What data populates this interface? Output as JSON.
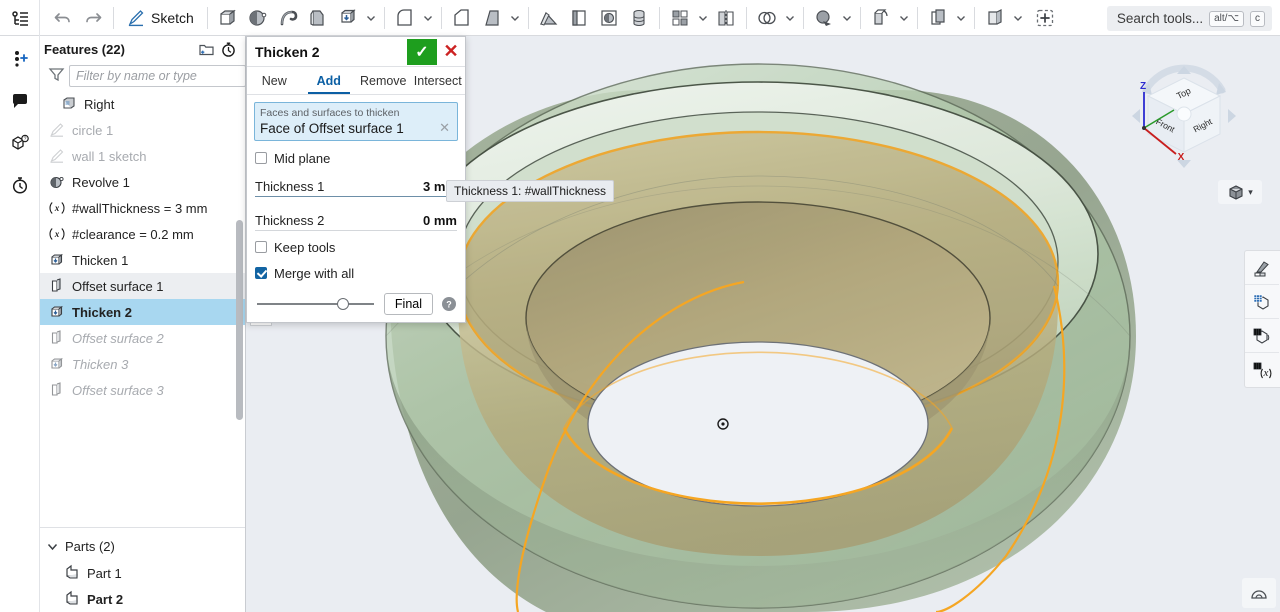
{
  "toolbar": {
    "history_icon": "feature-history-icon",
    "undo_label": "undo-icon",
    "redo_label": "redo-icon",
    "sketch_label": "Sketch",
    "tools": [
      {
        "name": "extrude-icon",
        "caret": false
      },
      {
        "name": "revolve-icon",
        "caret": false
      },
      {
        "name": "sweep-icon",
        "caret": false
      },
      {
        "name": "loft-icon",
        "caret": false
      },
      {
        "name": "thicken-icon",
        "caret": true
      },
      {
        "name": "fillet-icon",
        "caret": true
      },
      {
        "name": "chamfer-icon",
        "caret": false
      },
      {
        "name": "draft-icon",
        "caret": true
      },
      {
        "name": "rib-icon",
        "caret": false
      },
      {
        "name": "shell-icon",
        "caret": false
      },
      {
        "name": "hole-icon",
        "caret": false
      },
      {
        "name": "thread-icon",
        "caret": false
      },
      {
        "name": "pattern-icon",
        "caret": true
      },
      {
        "name": "mirror-icon",
        "caret": false
      },
      {
        "name": "boolean-icon",
        "caret": true
      },
      {
        "name": "split-icon",
        "caret": true
      },
      {
        "name": "transform-icon",
        "caret": true
      },
      {
        "name": "offset-surface-icon",
        "caret": true
      },
      {
        "name": "enclose-icon",
        "caret": true
      },
      {
        "name": "add-custom-feature-icon",
        "caret": false
      }
    ],
    "search_placeholder": "Search tools...",
    "search_kbd_1": "alt/⌥",
    "search_kbd_2": "c"
  },
  "rail": {
    "items": [
      {
        "name": "add-collaborator-icon"
      },
      {
        "name": "comment-icon"
      },
      {
        "name": "part-info-icon"
      },
      {
        "name": "history-icon"
      }
    ]
  },
  "tree": {
    "title": "Features (22)",
    "add_folder_icon": "add-folder-icon",
    "rollback_icon": "stopwatch-icon",
    "filter_placeholder": "Filter by name or type",
    "filter_value": "",
    "filter_icon": "filter-icon",
    "features": [
      {
        "label": "Right",
        "icon": "plane-icon",
        "state": "normal",
        "indent": true
      },
      {
        "label": "circle 1",
        "icon": "sketch-icon",
        "state": "dim",
        "indent": false
      },
      {
        "label": "wall 1 sketch",
        "icon": "sketch-icon",
        "state": "dim",
        "indent": false
      },
      {
        "label": "Revolve 1",
        "icon": "revolve-icon",
        "state": "normal",
        "indent": false
      },
      {
        "label": "#wallThickness = 3 mm",
        "icon": "variable-icon",
        "state": "normal",
        "indent": false
      },
      {
        "label": "#clearance = 0.2 mm",
        "icon": "variable-icon",
        "state": "normal",
        "indent": false
      },
      {
        "label": "Thicken 1",
        "icon": "thicken-icon",
        "state": "normal",
        "indent": false
      },
      {
        "label": "Offset surface 1",
        "icon": "offset-surface-icon",
        "state": "sel-light",
        "indent": false
      },
      {
        "label": "Thicken 2",
        "icon": "thicken-icon",
        "state": "sel-strong",
        "indent": false
      },
      {
        "label": "Offset surface 2",
        "icon": "offset-surface-icon",
        "state": "suppressed",
        "indent": false
      },
      {
        "label": "Thicken 3",
        "icon": "thicken-icon",
        "state": "suppressed",
        "indent": false
      },
      {
        "label": "Offset surface 3",
        "icon": "offset-surface-icon",
        "state": "suppressed",
        "indent": false
      }
    ],
    "parts_label": "Parts (2)",
    "parts": [
      {
        "label": "Part 1",
        "bold": false
      },
      {
        "label": "Part 2",
        "bold": true
      }
    ]
  },
  "dialog": {
    "title": "Thicken 2",
    "accept_glyph": "✓",
    "cancel_glyph": "✕",
    "tabs": [
      {
        "label": "New",
        "active": false
      },
      {
        "label": "Add",
        "active": true
      },
      {
        "label": "Remove",
        "active": false
      },
      {
        "label": "Intersect",
        "active": false
      }
    ],
    "selection_label": "Faces and surfaces to thicken",
    "selection_value": "Face of Offset surface 1",
    "mid_plane_label": "Mid plane",
    "mid_plane_checked": false,
    "thickness1_label": "Thickness 1",
    "thickness1_value": "3 mm",
    "thickness2_label": "Thickness 2",
    "thickness2_value": "0 mm",
    "keep_tools_label": "Keep tools",
    "keep_tools_checked": false,
    "merge_label": "Merge with all",
    "merge_checked": true,
    "final_label": "Final",
    "help_glyph": "?",
    "accent_color": "#0b5fa4",
    "ok_color": "#1e9e1e",
    "cancel_color": "#cc2222"
  },
  "tooltip": {
    "text": "Thickness 1: #wallThickness"
  },
  "viewcube": {
    "face_top": "Top",
    "face_front": "Front",
    "face_right": "Right",
    "axis_z": "Z",
    "axis_x": "X",
    "axis_z_color": "#2a2ad0",
    "axis_x_color": "#c81e1e",
    "axis_y_color": "#2a9a2a"
  },
  "view_tools": {
    "display_mode_icon": "shaded-cube-icon",
    "display_mode_caret": "▾",
    "buttons": [
      {
        "name": "appearance-icon"
      },
      {
        "name": "section-view-icon"
      },
      {
        "name": "explode-view-icon"
      },
      {
        "name": "measure-icon"
      }
    ],
    "bottom_right_icon": "view-orientation-icon"
  },
  "viewport": {
    "background": "#eaedf2",
    "model_outer_color": "#b9cfb4",
    "model_inner_color": "#b6ab7b",
    "highlight_color": "#f5a623",
    "origin_marker": "origin-icon"
  }
}
